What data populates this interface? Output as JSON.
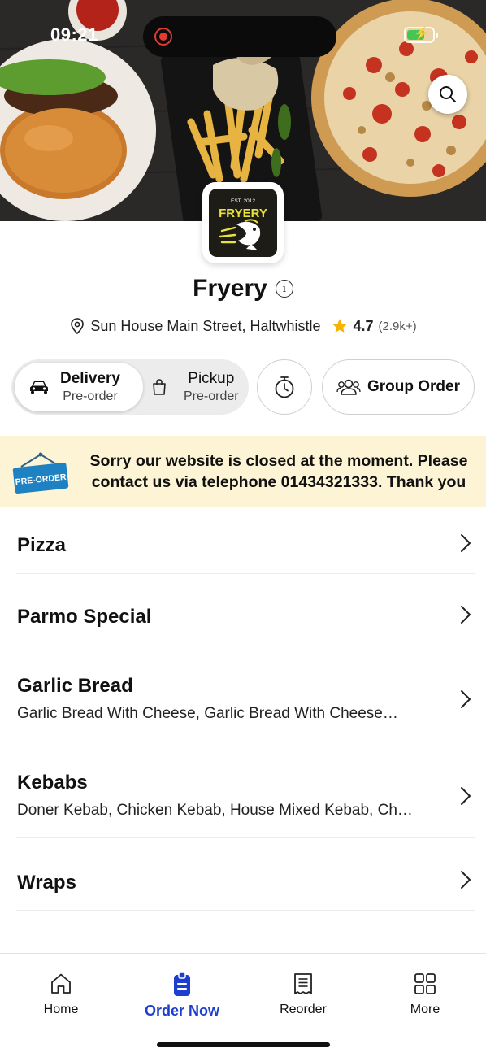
{
  "status_bar": {
    "time": "09:21"
  },
  "restaurant": {
    "name": "Fryery",
    "logo_text": "FRYERY",
    "logo_est": "EST. 2012",
    "address": "Sun House Main Street, Haltwhistle",
    "rating": "4.7",
    "rating_count": "(2.9k+)"
  },
  "order_modes": [
    {
      "label": "Delivery",
      "sub": "Pre-order",
      "active": true,
      "icon": "car-icon"
    },
    {
      "label": "Pickup",
      "sub": "Pre-order",
      "active": false,
      "icon": "bag-icon"
    }
  ],
  "actions": {
    "group_order": "Group Order",
    "timer_icon": "stopwatch-icon"
  },
  "banner": {
    "sign_text": "PRE-ORDER",
    "message": "Sorry our website is closed at the moment. Please contact us via telephone 01434321333. Thank you"
  },
  "menu": [
    {
      "title": "Pizza",
      "desc": ""
    },
    {
      "title": "Parmo Special",
      "desc": ""
    },
    {
      "title": "Garlic Bread",
      "desc": "Garlic Bread With Cheese, Garlic Bread With Cheese…"
    },
    {
      "title": "Kebabs",
      "desc": "Doner Kebab, Chicken Kebab, House Mixed Kebab, Ch…"
    },
    {
      "title": "Wraps",
      "desc": ""
    }
  ],
  "tabs": [
    {
      "label": "Home",
      "icon": "home-icon",
      "active": false
    },
    {
      "label": "Order Now",
      "icon": "order-icon",
      "active": true
    },
    {
      "label": "Reorder",
      "icon": "receipt-icon",
      "active": false
    },
    {
      "label": "More",
      "icon": "grid-icon",
      "active": false
    }
  ],
  "colors": {
    "accent": "#1d3fcf",
    "banner_bg": "#fcf4d4",
    "star": "#f5b400",
    "logo_yellow": "#e8e23a"
  }
}
